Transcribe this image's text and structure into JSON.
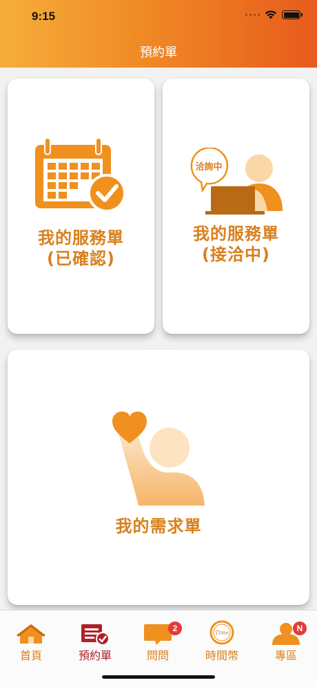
{
  "status_bar": {
    "time": "9:15"
  },
  "header": {
    "title": "預約單"
  },
  "cards": {
    "confirmed": {
      "line1": "我的服務單",
      "line2": "(已確認)"
    },
    "negotiating": {
      "line1": "我的服務單",
      "line2": "(接洽中)",
      "bubble_text": "洽詢中"
    },
    "demand": {
      "label": "我的需求單"
    }
  },
  "tabbar": {
    "items": [
      {
        "label": "首頁",
        "icon": "home-icon",
        "active": false
      },
      {
        "label": "預約單",
        "icon": "booking-icon",
        "active": true
      },
      {
        "label": "問問",
        "icon": "chat-icon",
        "active": false,
        "badge": "2"
      },
      {
        "label": "時間幣",
        "icon": "time-coin-icon",
        "active": false,
        "coin_text": "Time"
      },
      {
        "label": "專區",
        "icon": "user-icon",
        "active": false,
        "badge": "N"
      }
    ]
  },
  "colors": {
    "brand_orange": "#f08a25",
    "label_orange": "#d9801c",
    "active_tab": "#b0202a",
    "badge_red": "#e53a3a"
  }
}
